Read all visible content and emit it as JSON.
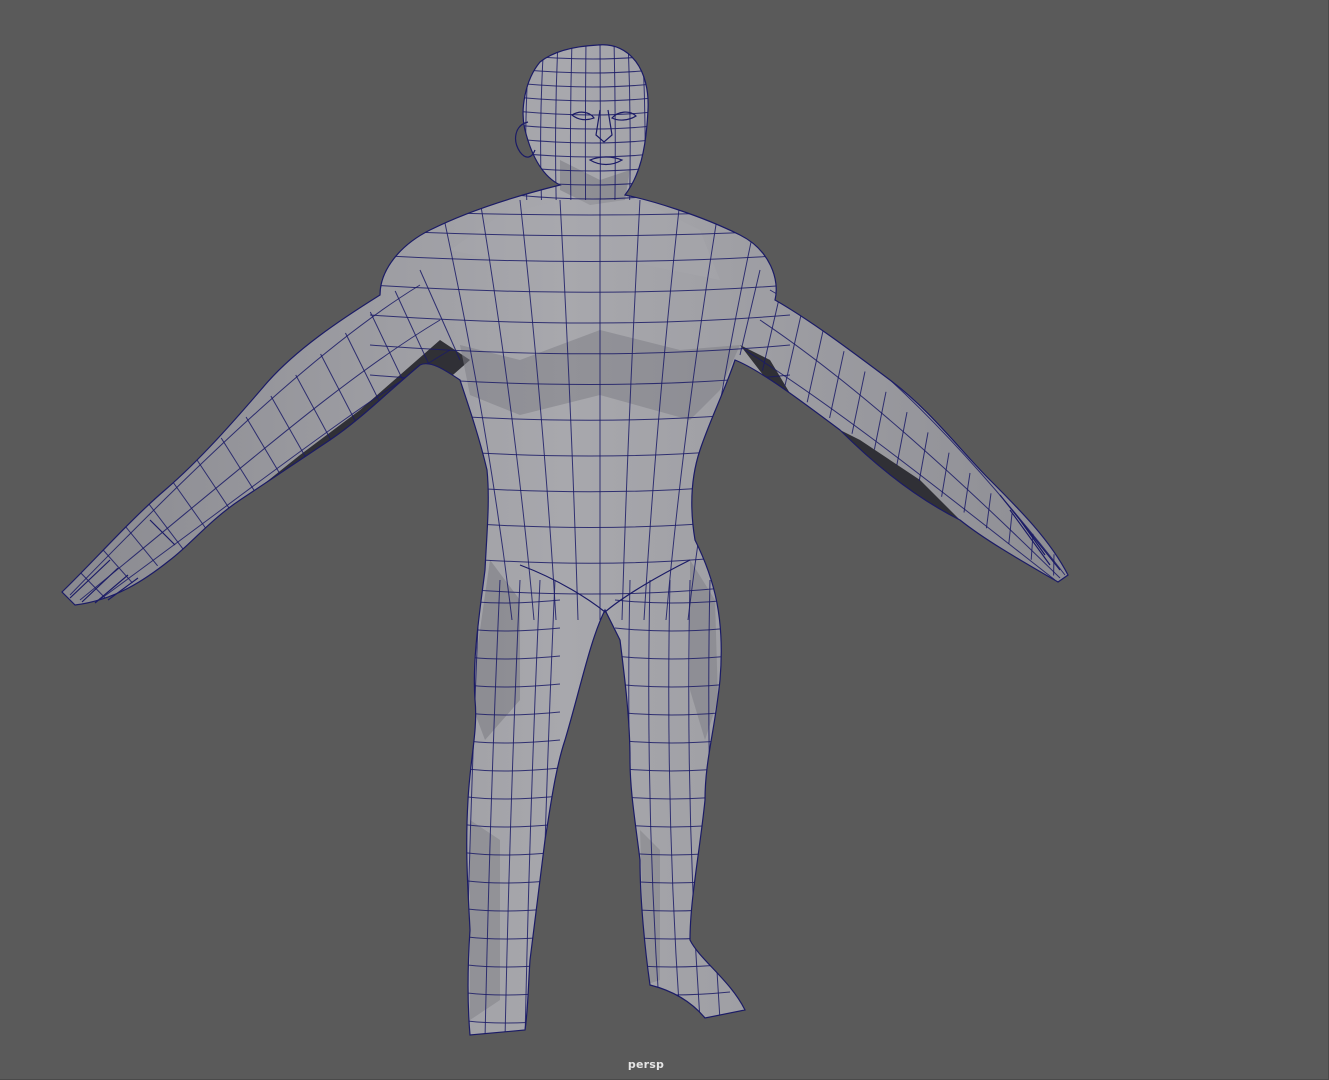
{
  "viewport": {
    "camera_label": "persp",
    "background_color": "#5a5a5a",
    "wireframe_color": "#1b1b66",
    "mesh_color": "#9c9ca2"
  },
  "scene": {
    "object": "low-poly-humanoid-a-pose-mesh"
  }
}
